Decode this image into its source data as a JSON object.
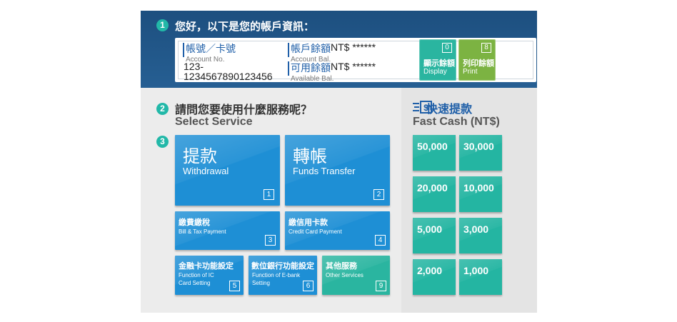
{
  "header": {
    "step": "1",
    "greeting": "您好，以下是您的帳戶資訊：",
    "account": {
      "label_zh": "帳號／卡號",
      "label_en": "Account No.",
      "number": "123-1234567890123456"
    },
    "balance": {
      "label_zh": "帳戶餘額",
      "label_en": "Account Bal.",
      "value": "NT$ ******"
    },
    "available": {
      "label_zh": "可用餘額",
      "label_en": "Available Bal.",
      "value": "NT$ ******"
    },
    "display_button": {
      "key": "0",
      "label_zh": "顯示餘額",
      "label_en": "Display",
      "color": "#2ab5a0"
    },
    "print_button": {
      "key": "8",
      "label_zh": "列印餘額",
      "label_en": "Print",
      "color": "#7cb342"
    }
  },
  "select": {
    "step": "2",
    "title_zh": "請問您要使用什麼服務呢？",
    "title_en": "Select Service"
  },
  "services": {
    "step": "3",
    "withdrawal": {
      "zh": "提款",
      "en": "Withdrawal",
      "key": "1"
    },
    "transfer": {
      "zh": "轉帳",
      "en": "Funds Transfer",
      "key": "2"
    },
    "bill": {
      "zh": "繳費繳稅",
      "en": "Bill & Tax Payment",
      "key": "3"
    },
    "credit": {
      "zh": "繳信用卡款",
      "en": "Credit Card Payment",
      "key": "4"
    },
    "ic_card": {
      "zh": "金融卡功能設定",
      "en_line1": "Function of IC",
      "en_line2": "Card Setting",
      "key": "5"
    },
    "ebank": {
      "zh": "數位銀行功能設定",
      "en_line1": "Function of E-bank",
      "en_line2": "Setting",
      "key": "6"
    },
    "other": {
      "zh": "其他服務",
      "en": "Other Services",
      "key": "9"
    }
  },
  "fast_cash": {
    "icon": "cash-icon",
    "title_zh": "快速提款",
    "title_en": "Fast Cash (NT$)",
    "amounts": [
      "50,000",
      "30,000",
      "20,000",
      "10,000",
      "5,000",
      "3,000",
      "2,000",
      "1,000"
    ]
  },
  "colors": {
    "header": "#1d4f7f",
    "service_blue": "#1e8fd5",
    "teal": "#2ab5a0",
    "accent_text": "#1f5fa8"
  }
}
